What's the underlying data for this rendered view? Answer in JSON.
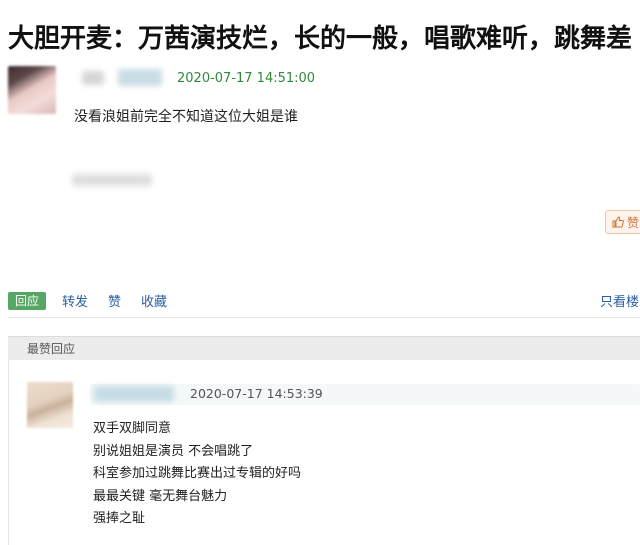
{
  "post": {
    "title": "大胆开麦：万茜演技烂，长的一般，唱歌难听，跳舞差",
    "timestamp": "2020-07-17 14:51:00",
    "text": "没看浪姐前完全不知道这位大姐是谁",
    "like_label": "赞"
  },
  "actions": {
    "reply": "回应",
    "forward": "转发",
    "like": "赞",
    "favorite": "收藏",
    "only_view": "只看楼"
  },
  "section": {
    "title": "最赞回应"
  },
  "reply": {
    "timestamp": "2020-07-17 14:53:39",
    "lines": [
      "双手双脚同意",
      "别说姐姐是演员 不会唱跳了",
      "科室参加过跳舞比赛出过专辑的好吗",
      "最最关键 毫无舞台魅力",
      "强捧之耻"
    ]
  },
  "colors": {
    "timestamp_green": "#2f8a3b",
    "link_blue": "#2a5fa3",
    "reply_button_green": "#57a764",
    "like_orange": "#c8773a"
  },
  "icons": {
    "like": "thumbs-up-icon"
  }
}
